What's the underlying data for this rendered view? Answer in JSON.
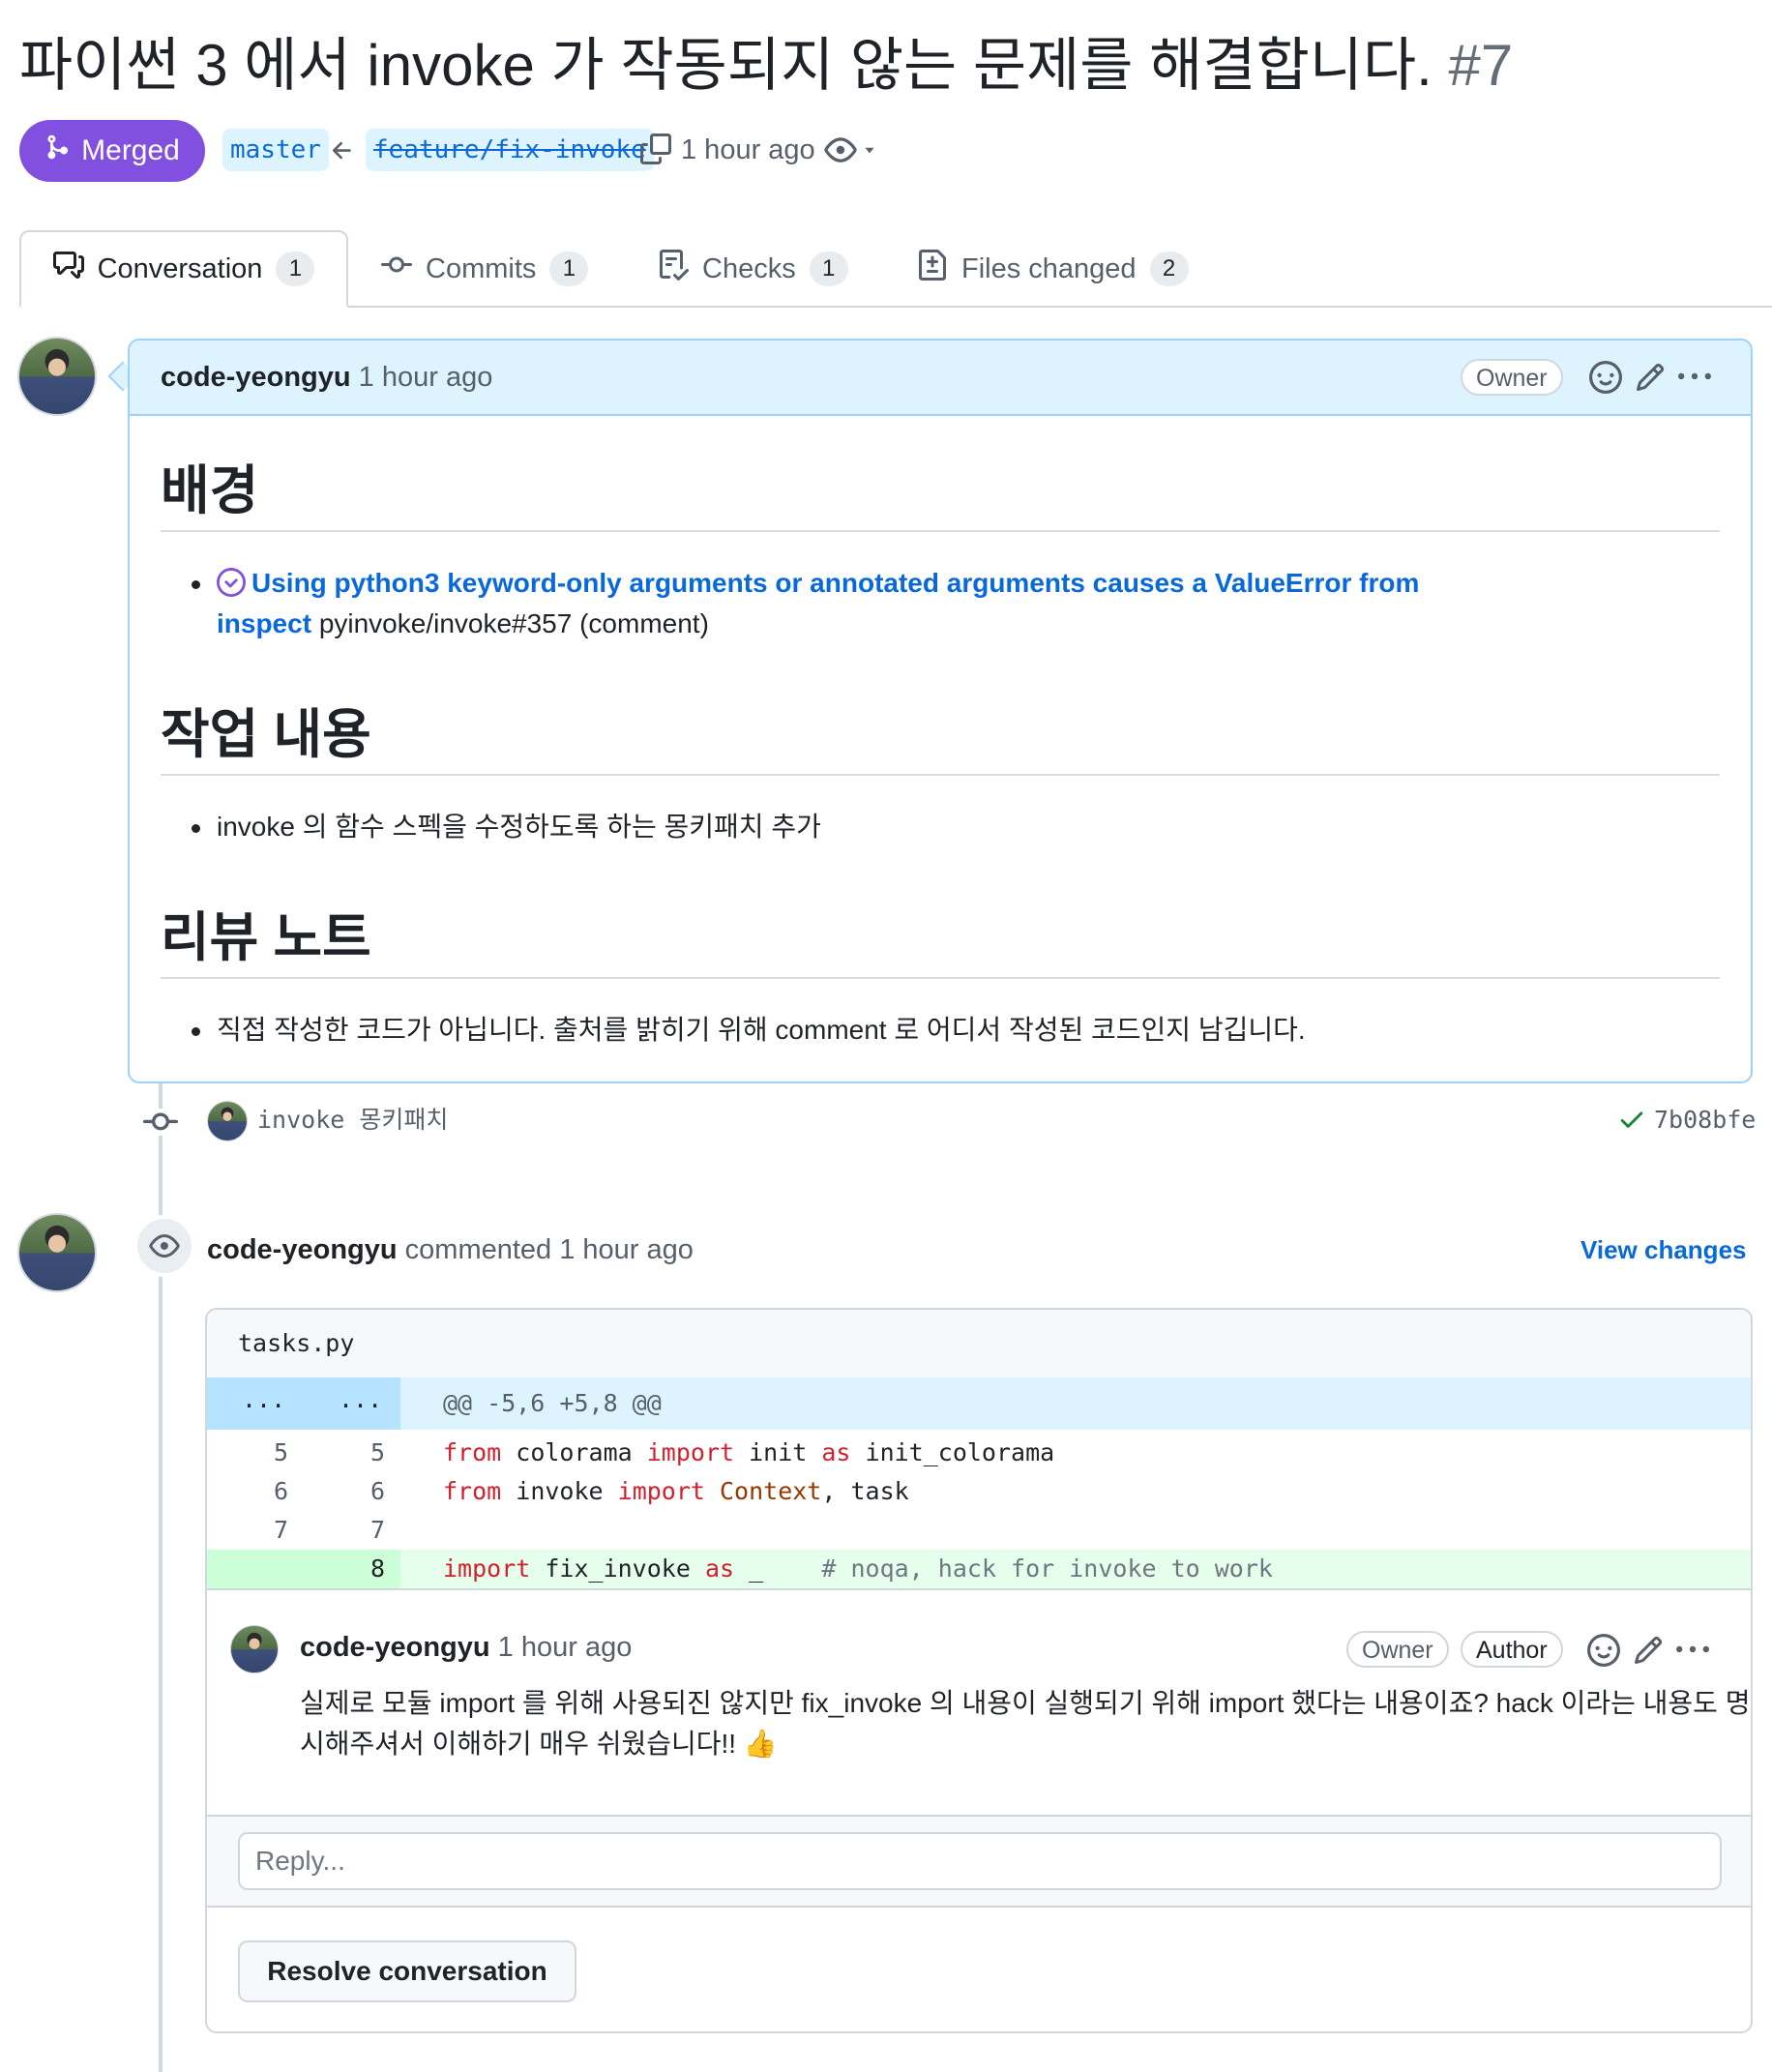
{
  "pr": {
    "title": "파이썬 3 에서 invoke 가 작동되지 않는 문제를 해결합니다.",
    "number": "#7",
    "status": "Merged",
    "base_branch": "master",
    "head_branch": "feature/fix-invoke",
    "time": "1 hour ago"
  },
  "tabs": [
    {
      "label": "Conversation",
      "count": "1"
    },
    {
      "label": "Commits",
      "count": "1"
    },
    {
      "label": "Checks",
      "count": "1"
    },
    {
      "label": "Files changed",
      "count": "2"
    }
  ],
  "comment": {
    "author": "code-yeongyu",
    "time": "1 hour ago",
    "badge": "Owner",
    "h_background": "배경",
    "issue_link_1": "Using python3 keyword-only arguments or annotated arguments causes a ValueError from",
    "issue_link_2": "inspect",
    "issue_ref": "pyinvoke/invoke#357 (comment)",
    "h_work": "작업 내용",
    "work_item": "invoke 의 함수 스펙을 수정하도록 하는 몽키패치 추가",
    "h_review": "리뷰 노트",
    "review_item": "직접 작성한 코드가 아닙니다. 출처를 밝히기 위해 comment 로 어디서 작성된 코드인지 남깁니다."
  },
  "commit": {
    "message": "invoke 몽키패치",
    "sha": "7b08bfe"
  },
  "review": {
    "author": "code-yeongyu",
    "action": "commented",
    "time": "1 hour ago",
    "view_changes": "View changes",
    "file": "tasks.py",
    "hunk": "@@ -5,6 +5,8 @@",
    "hunk_dots": "...",
    "lines": [
      {
        "old": "5",
        "new": "5"
      },
      {
        "old": "6",
        "new": "6"
      },
      {
        "old": "7",
        "new": "7"
      },
      {
        "old": "",
        "new": "8"
      }
    ],
    "code": {
      "l1_from": "from",
      "l1_mod": " colorama ",
      "l1_import": "import",
      "l1_name": " init ",
      "l1_as": "as",
      "l1_alias": " init_colorama",
      "l2_from": "from",
      "l2_mod": " invoke ",
      "l2_import": "import",
      "l2_cls": " Context",
      "l2_rest": ", task",
      "l4_import": "import",
      "l4_mod": " fix_invoke ",
      "l4_as": "as",
      "l4_alias": " _",
      "l4_comment": "# noqa, hack for invoke to work"
    },
    "reply": {
      "author": "code-yeongyu",
      "time": "1 hour ago",
      "badge_owner": "Owner",
      "badge_author": "Author",
      "text_1": "실제로 모듈 import 를 위해 사용되진 않지만 fix_invoke 의 내용이 실행되기 위해 import 했다는 내용이죠? hack 이라는 내용도 명",
      "text_2": "시해주셔서 이해하기 매우 쉬웠습니다!! 👍"
    },
    "reply_placeholder": "Reply...",
    "resolve_label": "Resolve conversation"
  },
  "colors": {
    "merged": "#8250df",
    "link": "#0969da",
    "added_bg": "#e6ffec",
    "hunk_bg": "#ddf4ff"
  }
}
